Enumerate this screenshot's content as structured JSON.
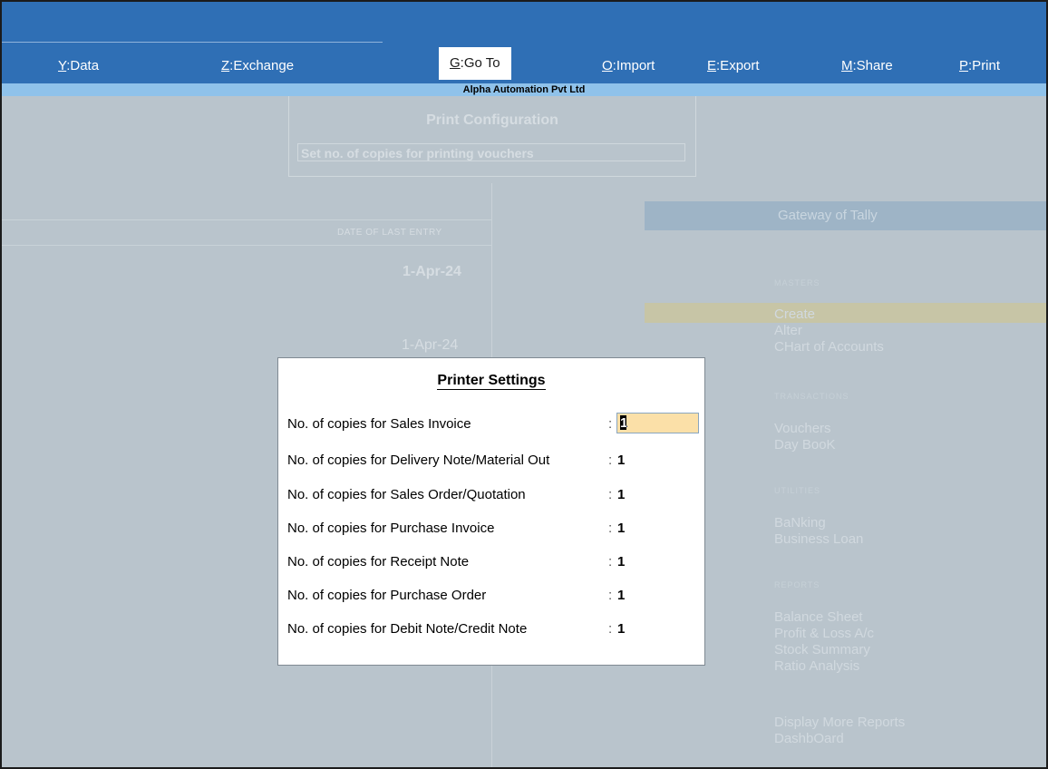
{
  "menu": {
    "data": {
      "key": "Y",
      "label": ":Data"
    },
    "exchange": {
      "key": "Z",
      "label": ":Exchange"
    },
    "goto": {
      "key": "G",
      "label": ":Go To"
    },
    "import": {
      "key": "O",
      "label": ":Import"
    },
    "export": {
      "key": "E",
      "label": ":Export"
    },
    "share": {
      "key": "M",
      "label": ":Share"
    },
    "print": {
      "key": "P",
      "label": ":Print"
    }
  },
  "company_name": "Alpha Automation Pvt Ltd",
  "background": {
    "print_configuration_title": "Print Configuration",
    "print_configuration_field": "Set no. of copies for printing vouchers",
    "date_of_last_entry_header": "DATE OF LAST ENTRY",
    "date_1": "1-Apr-24",
    "date_2": "1-Apr-24",
    "gateway_title": "Gateway of Tally",
    "sections": {
      "masters": "MASTERS",
      "transactions": "TRANSACTIONS",
      "utilities": "UTILITIES",
      "reports": "REPORTS"
    },
    "items": {
      "create": "Create",
      "alter": "Alter",
      "chart_of_accounts": "CHart of Accounts",
      "vouchers": "Vouchers",
      "day_book": "Day BooK",
      "banking": "BaNking",
      "business_loan": "Business Loan",
      "balance_sheet": "Balance Sheet",
      "profit_loss": "Profit & Loss A/c",
      "stock_summary": "Stock Summary",
      "ratio_analysis": "Ratio Analysis",
      "display_more_reports": "Display More Reports",
      "dashboard": "DashbOard"
    }
  },
  "dialog": {
    "title": "Printer Settings",
    "rows": [
      {
        "label": "No. of copies for Sales Invoice",
        "value": "1"
      },
      {
        "label": "No. of copies for Delivery Note/Material Out",
        "value": "1"
      },
      {
        "label": "No. of copies for Sales Order/Quotation",
        "value": "1"
      },
      {
        "label": "No. of copies for Purchase Invoice",
        "value": "1"
      },
      {
        "label": "No. of copies for Receipt Note",
        "value": "1"
      },
      {
        "label": "No. of copies for Purchase Order",
        "value": "1"
      },
      {
        "label": "No. of copies for Debit Note/Credit Note",
        "value": "1"
      }
    ],
    "colon": ":"
  },
  "colors": {
    "topbar": "#2f6fb5",
    "company_strip": "#8fc2ea",
    "overlay_background": "#b9c4cc",
    "active_field": "#fbe0a8"
  }
}
